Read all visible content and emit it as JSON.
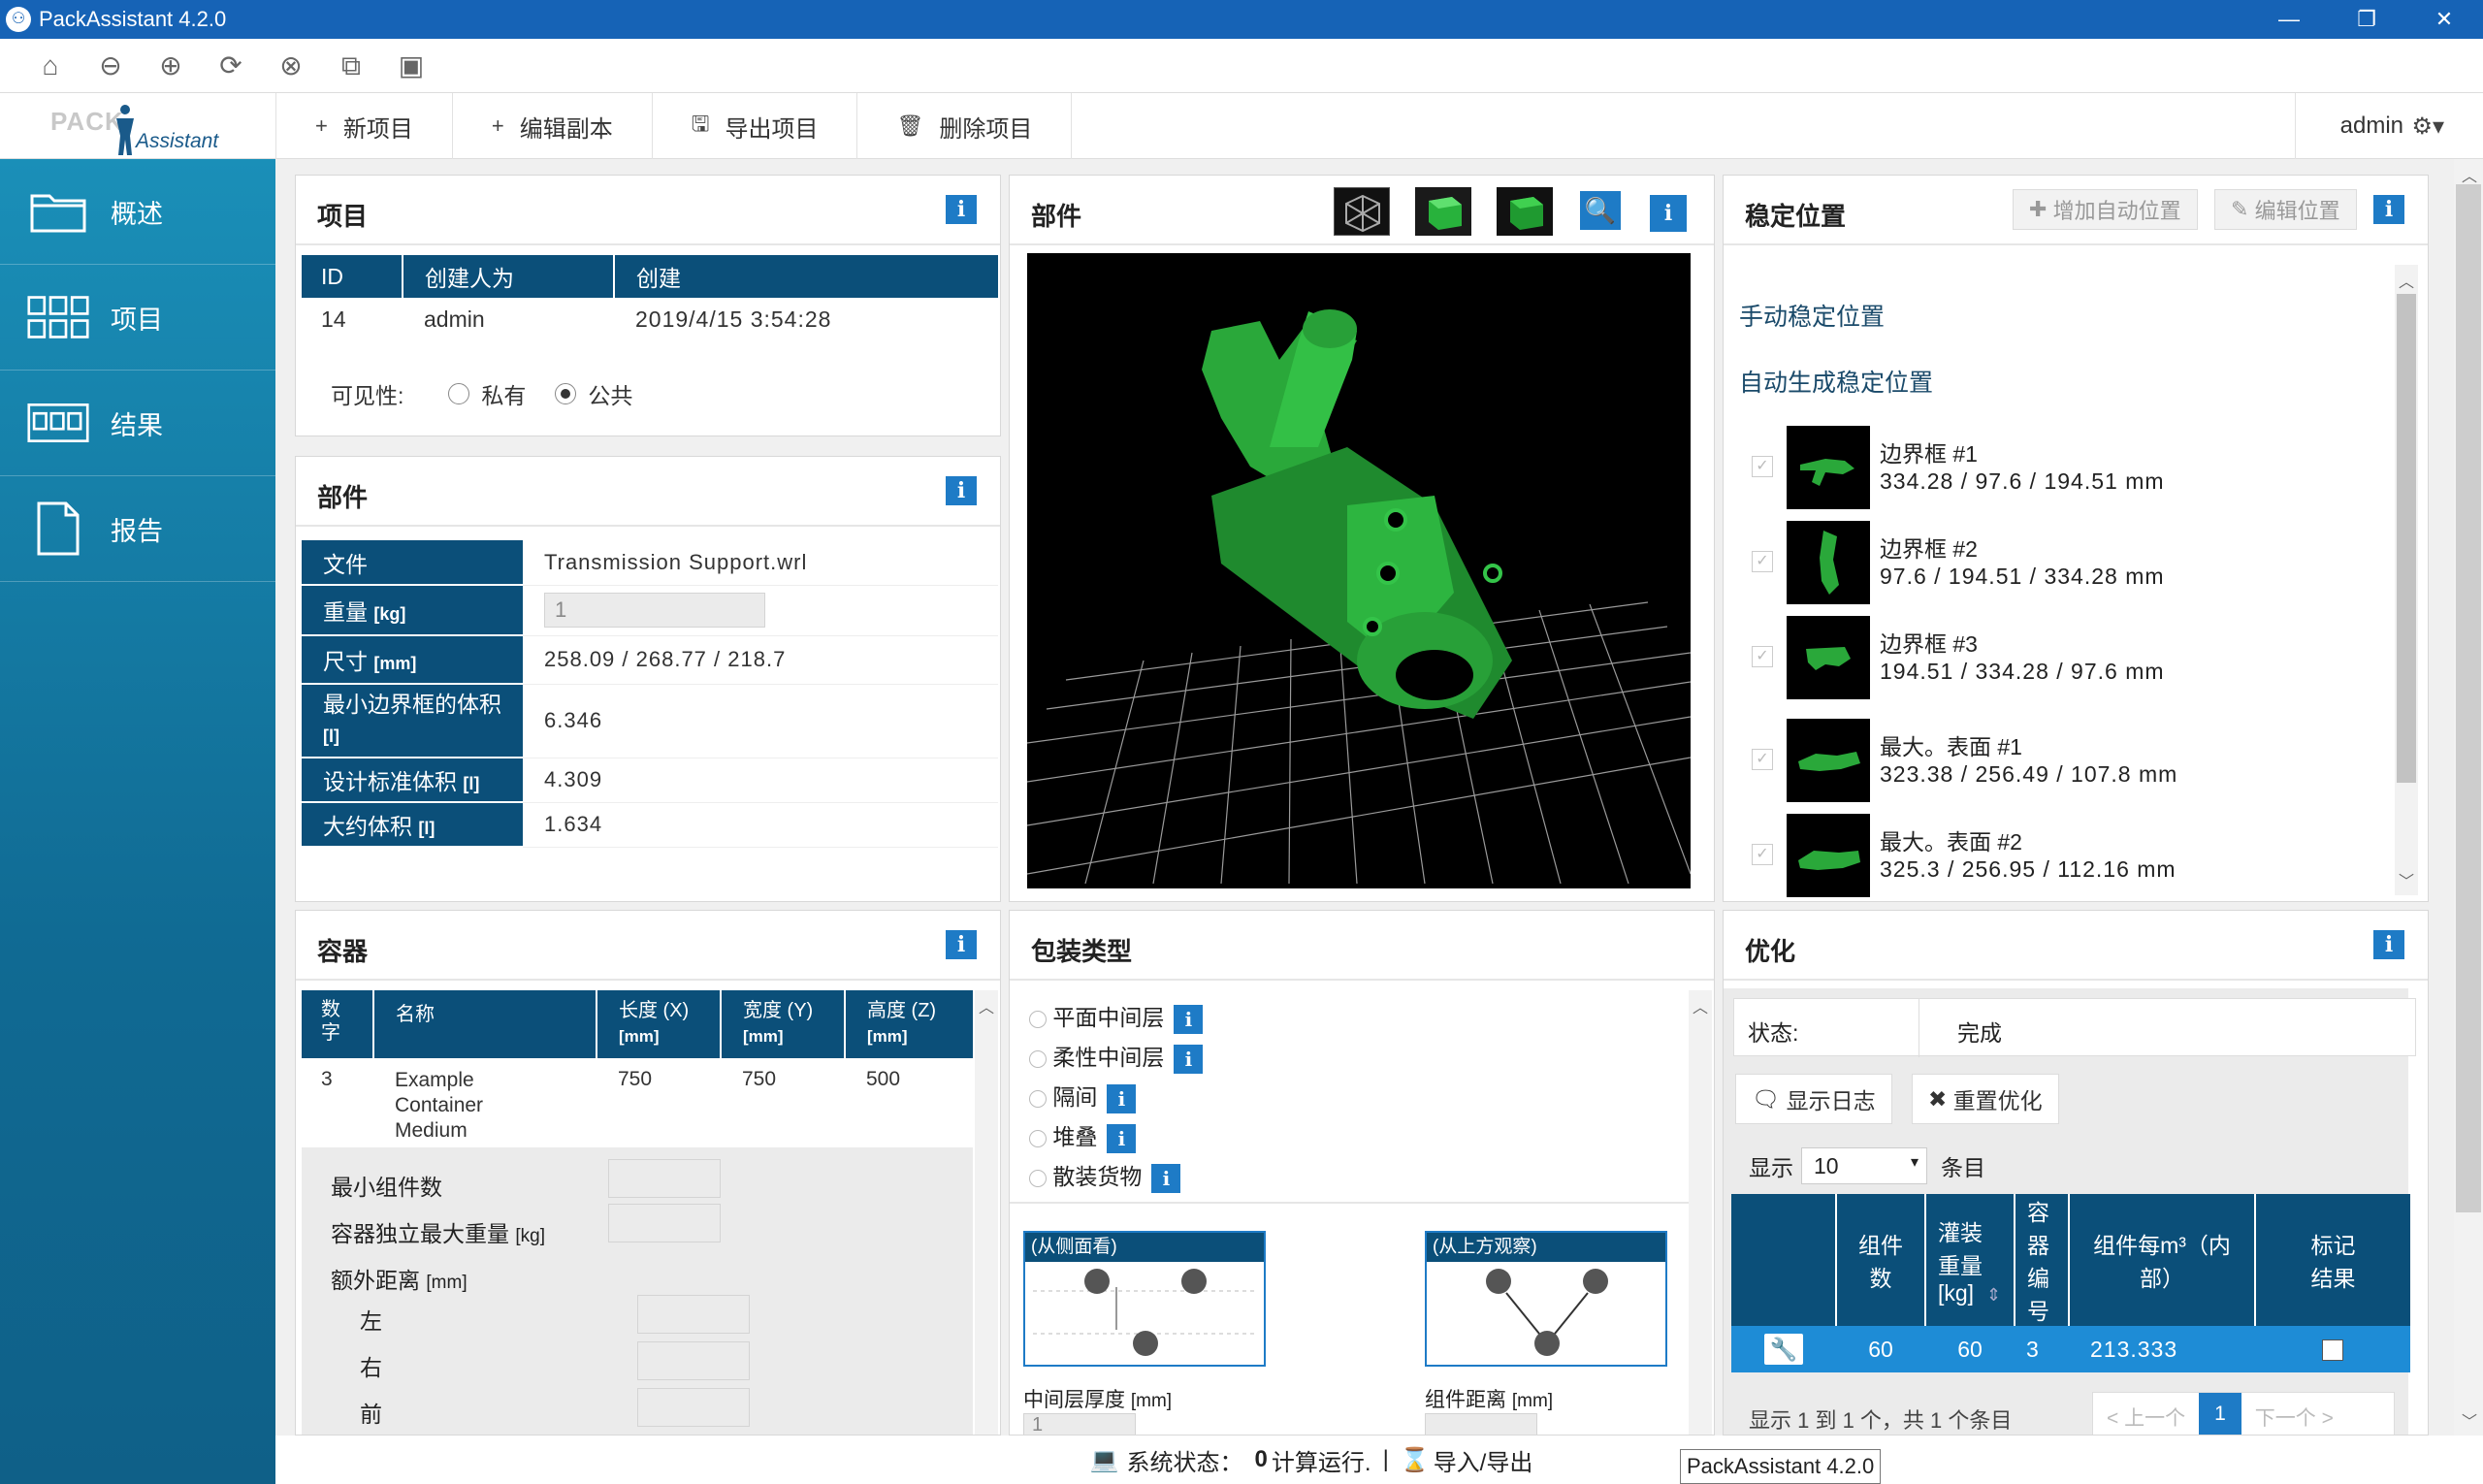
{
  "window": {
    "title": "PackAssistant 4.2.0",
    "min": "—",
    "restore": "❐",
    "close": "✕"
  },
  "logo": {
    "pack": "PACK",
    "assistant": "Assistant"
  },
  "toolbar": {
    "actions": [
      {
        "icon": "+",
        "label": "新项目"
      },
      {
        "icon": "+",
        "label": "编辑副本"
      },
      {
        "icon": "🖫",
        "label": "导出项目"
      },
      {
        "icon": "🗑",
        "label": "删除项目"
      }
    ],
    "user": "admin"
  },
  "sidebar": {
    "items": [
      {
        "label": "概述",
        "icon": "folder-icon"
      },
      {
        "label": "项目",
        "icon": "grid-icon"
      },
      {
        "label": "结果",
        "icon": "results-icon"
      },
      {
        "label": "报告",
        "icon": "document-icon"
      }
    ]
  },
  "project": {
    "title": "项目",
    "columns": [
      "ID",
      "创建人为",
      "创建"
    ],
    "row": [
      "14",
      "admin",
      "2019/4/15 3:54:28"
    ],
    "visibility_label": "可见性:",
    "private": "私有",
    "public": "公共"
  },
  "part": {
    "title": "部件",
    "rows": [
      {
        "k": "文件",
        "v": "Transmission Support.wrl"
      },
      {
        "k": "重量",
        "unit": "[kg]",
        "v": "1"
      },
      {
        "k": "尺寸",
        "unit": "[mm]",
        "v": "258.09 / 268.77 / 218.7"
      },
      {
        "k": "最小边界框的体积",
        "unit": "[l]",
        "v": "6.346"
      },
      {
        "k": "设计标准体积",
        "unit": "[l]",
        "v": "4.309"
      },
      {
        "k": "大约体积",
        "unit": "[l]",
        "v": "1.634"
      }
    ]
  },
  "viewer": {
    "title": "部件"
  },
  "stable": {
    "title": "稳定位置",
    "add_auto": "增加自动位置",
    "edit": "编辑位置",
    "manual": "手动稳定位置",
    "auto": "自动生成稳定位置",
    "items": [
      {
        "name": "边界框 #1",
        "dims": "334.28 / 97.6 / 194.51 mm"
      },
      {
        "name": "边界框 #2",
        "dims": "97.6 / 194.51 / 334.28 mm"
      },
      {
        "name": "边界框 #3",
        "dims": "194.51 / 334.28 / 97.6 mm"
      },
      {
        "name": "最大。表面 #1",
        "dims": "323.38 / 256.49 / 107.8 mm"
      },
      {
        "name": "最大。表面 #2",
        "dims": "325.3 / 256.95 / 112.16 mm"
      }
    ]
  },
  "container": {
    "title": "容器",
    "columns": [
      {
        "label": "数字"
      },
      {
        "label": "名称"
      },
      {
        "label": "长度 (X)",
        "unit": "[mm]"
      },
      {
        "label": "宽度 (Y)",
        "unit": "[mm]"
      },
      {
        "label": "高度 (Z)",
        "unit": "[mm]"
      }
    ],
    "row": {
      "num": "3",
      "name": "Example Container Medium",
      "l": "750",
      "w": "750",
      "h": "500"
    },
    "min_parts": "最小组件数",
    "max_weight": "容器独立最大重量",
    "max_weight_unit": "[kg]",
    "extra_dist": "额外距离",
    "extra_dist_unit": "[mm]",
    "left": "左",
    "right": "右",
    "front": "前"
  },
  "packing": {
    "title": "包装类型",
    "options": [
      "平面中间层",
      "柔性中间层",
      "隔间",
      "堆叠",
      "散装货物"
    ],
    "side_view": "(从侧面看)",
    "top_view": "(从上方观察)",
    "layer_thickness": "中间层厚度",
    "layer_thickness_unit": "[mm]",
    "part_distance": "组件距离",
    "part_distance_unit": "[mm]",
    "layer_value": "1"
  },
  "optimize": {
    "title": "优化",
    "status_label": "状态:",
    "status_value": "完成",
    "show_log": "显示日志",
    "reset": "重置优化",
    "show": "显示",
    "page_size": "10",
    "entries": "条目",
    "columns": [
      "组件数",
      "灌装重量 [kg]",
      "容器编号",
      "组件每m³（内部）",
      "标记结果"
    ],
    "row": {
      "parts": "60",
      "weight": "60",
      "container": "3",
      "per_m3": "213.333"
    },
    "summary": "显示 1 到 1 个，共 1 个条目",
    "prev": "< 上一个",
    "page": "1",
    "next": "下一个 >"
  },
  "status": {
    "system": "系统状态：",
    "count": "0",
    "running": "计算运行.",
    "sep": "|",
    "import": "导入/导出",
    "tooltip": "PackAssistant 4.2.0"
  }
}
